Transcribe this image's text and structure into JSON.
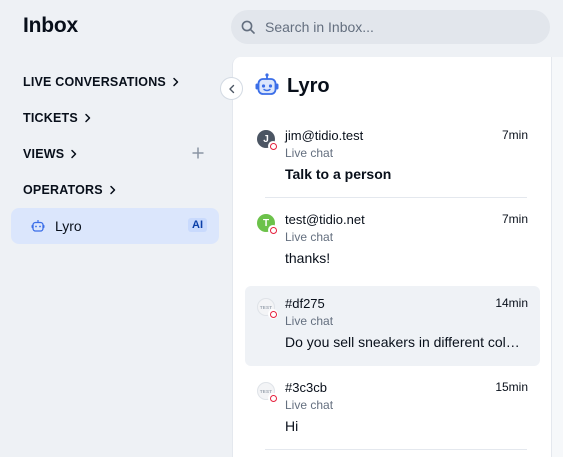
{
  "header": {
    "title": "Inbox",
    "search_placeholder": "Search in Inbox..."
  },
  "sidebar": {
    "sections": [
      {
        "label": "LIVE CONVERSATIONS"
      },
      {
        "label": "TICKETS"
      },
      {
        "label": "VIEWS"
      },
      {
        "label": "OPERATORS"
      }
    ],
    "active_item": {
      "label": "Lyro",
      "badge": "AI"
    }
  },
  "panel": {
    "title": "Lyro",
    "conversations": [
      {
        "avatar_letter": "J",
        "avatar_color": "#4b5563",
        "name": "jim@tidio.test",
        "time": "7min",
        "channel": "Live chat",
        "message": "Talk to a person",
        "bold": true,
        "selected": false
      },
      {
        "avatar_letter": "T",
        "avatar_color": "#6cc24a",
        "name": "test@tidio.net",
        "time": "7min",
        "channel": "Live chat",
        "message": "thanks!",
        "bold": false,
        "selected": false
      },
      {
        "avatar_letter": "TEST",
        "avatar_color": "#f3f4f6",
        "name": "#df275",
        "time": "14min",
        "channel": "Live chat",
        "message": "Do you sell sneakers in different colors?",
        "bold": false,
        "selected": true
      },
      {
        "avatar_letter": "TEST",
        "avatar_color": "#f3f4f6",
        "name": "#3c3cb",
        "time": "15min",
        "channel": "Live chat",
        "message": "Hi",
        "bold": false,
        "selected": false
      }
    ]
  },
  "colors": {
    "accent": "#0b3fa8",
    "status_red": "#e5203d",
    "active_bg": "#dbe6fc"
  }
}
